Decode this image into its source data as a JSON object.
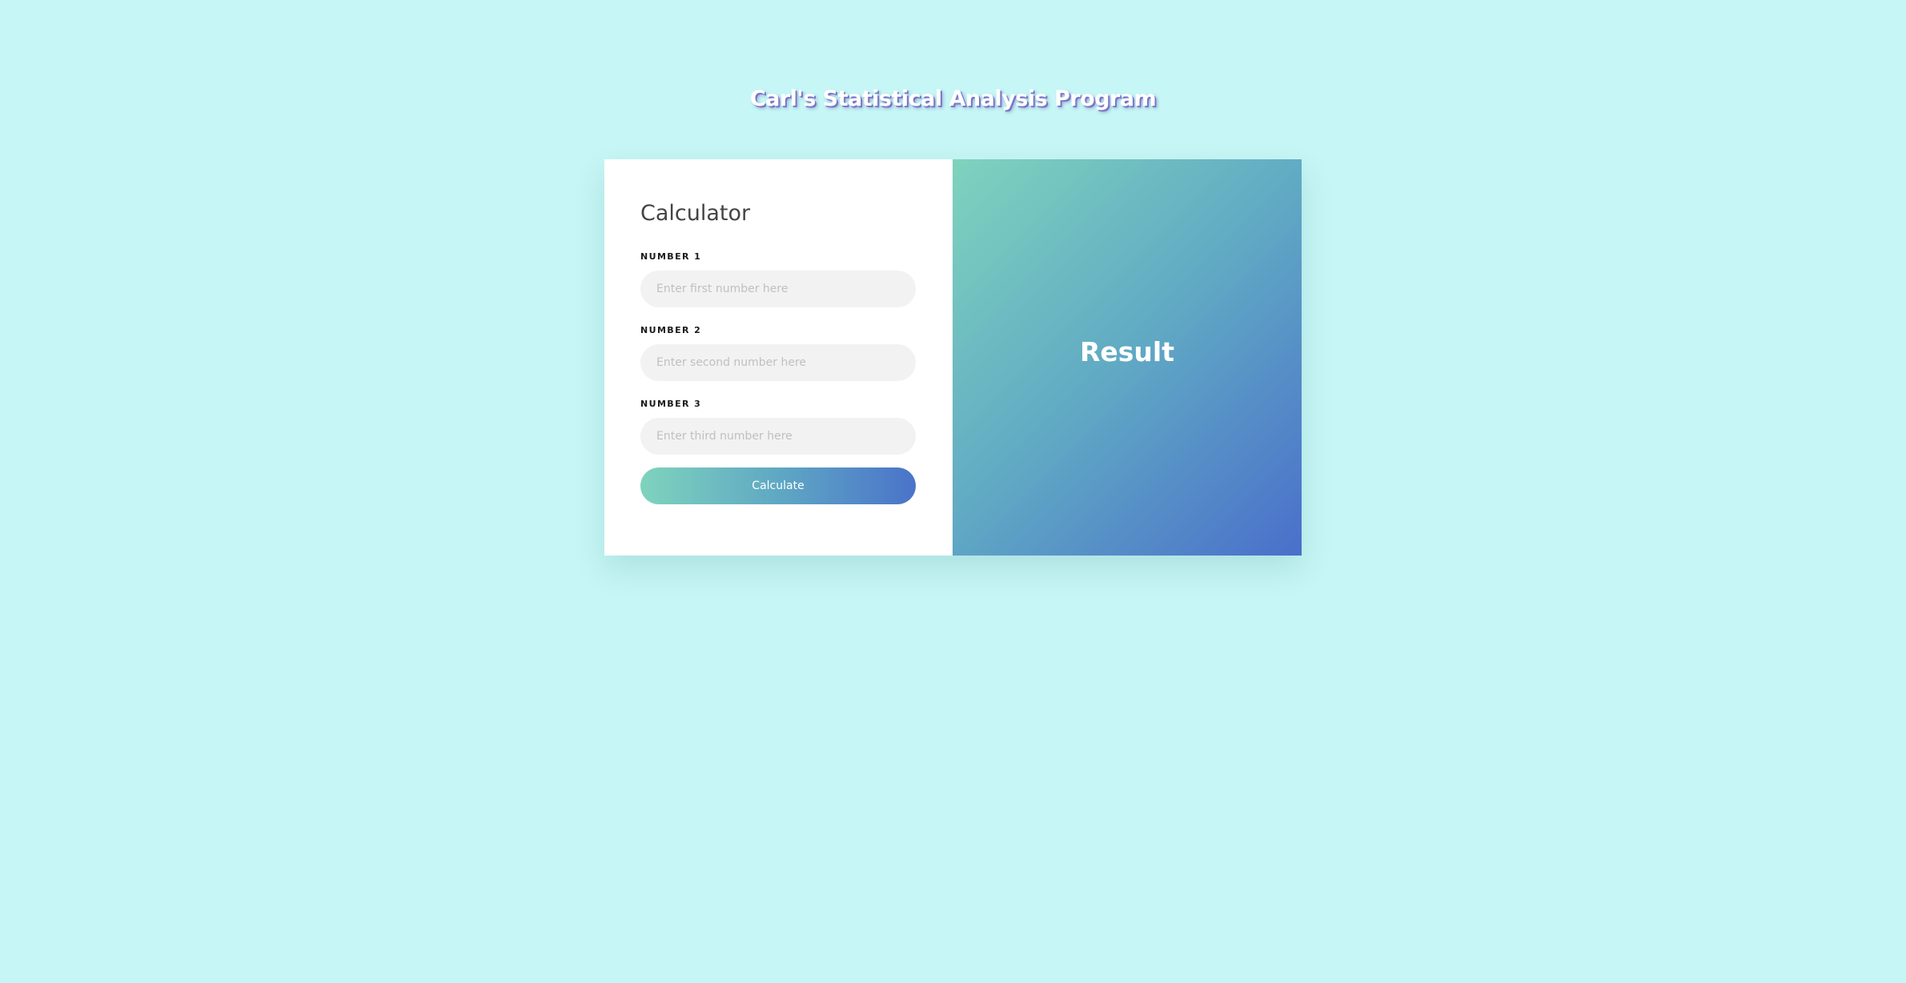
{
  "header": {
    "title": "Carl's Statistical Analysis Program"
  },
  "calculator": {
    "title": "Calculator",
    "fields": [
      {
        "label": "NUMBER 1",
        "placeholder": "Enter first number here",
        "value": ""
      },
      {
        "label": "NUMBER 2",
        "placeholder": "Enter second number here",
        "value": ""
      },
      {
        "label": "NUMBER 3",
        "placeholder": "Enter third number here",
        "value": ""
      }
    ],
    "button_label": "Calculate"
  },
  "result": {
    "text": "Result"
  },
  "colors": {
    "background": "#c6f6f5",
    "gradient_start": "#7fd3bd",
    "gradient_end": "#4a6fcb",
    "title_shadow": "#7a76c8"
  }
}
